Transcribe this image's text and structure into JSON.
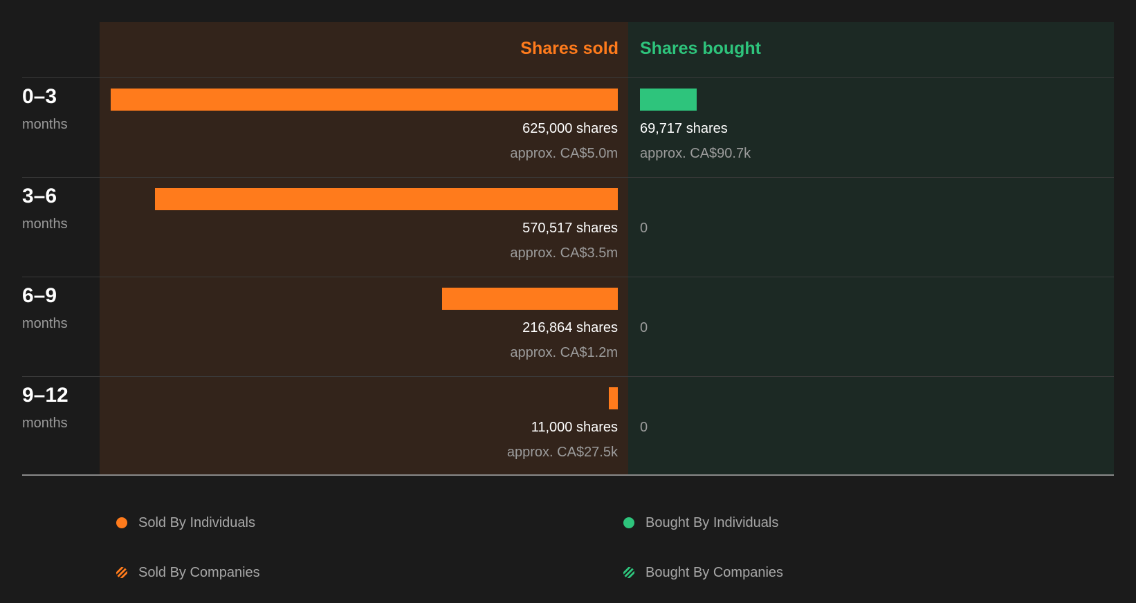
{
  "colors": {
    "sold": "#ff7b1c",
    "bought": "#2ec47c",
    "background": "#1b1b1b"
  },
  "header": {
    "sold_label": "Shares sold",
    "bought_label": "Shares bought"
  },
  "rows": [
    {
      "range": "0–3",
      "unit": "months",
      "sold_shares_text": "625,000 shares",
      "sold_value_text": "approx. CA$5.0m",
      "bought_shares_text": "69,717 shares",
      "bought_value_text": "approx. CA$90.7k"
    },
    {
      "range": "3–6",
      "unit": "months",
      "sold_shares_text": "570,517 shares",
      "sold_value_text": "approx. CA$3.5m",
      "bought_shares_text": "0",
      "bought_value_text": ""
    },
    {
      "range": "6–9",
      "unit": "months",
      "sold_shares_text": "216,864 shares",
      "sold_value_text": "approx. CA$1.2m",
      "bought_shares_text": "0",
      "bought_value_text": ""
    },
    {
      "range": "9–12",
      "unit": "months",
      "sold_shares_text": "11,000 shares",
      "sold_value_text": "approx. CA$27.5k",
      "bought_shares_text": "0",
      "bought_value_text": ""
    }
  ],
  "legend": [
    {
      "label": "Sold By Individuals",
      "icon": "solid-orange-dot"
    },
    {
      "label": "Bought By Individuals",
      "icon": "solid-green-dot"
    },
    {
      "label": "Sold By Companies",
      "icon": "striped-orange-dot"
    },
    {
      "label": "Bought By Companies",
      "icon": "striped-green-dot"
    }
  ],
  "chart_data": {
    "type": "bar",
    "categories": [
      "0–3 months",
      "3–6 months",
      "6–9 months",
      "9–12 months"
    ],
    "series": [
      {
        "name": "Shares sold",
        "values": [
          625000,
          570517,
          216864,
          11000
        ]
      },
      {
        "name": "Shares bought",
        "values": [
          69717,
          0,
          0,
          0
        ]
      }
    ],
    "value_labels": {
      "sold": [
        "approx. CA$5.0m",
        "approx. CA$3.5m",
        "approx. CA$1.2m",
        "approx. CA$27.5k"
      ],
      "bought": [
        "approx. CA$90.7k",
        "",
        "",
        ""
      ]
    },
    "legend_position": "bottom",
    "grid": false
  }
}
